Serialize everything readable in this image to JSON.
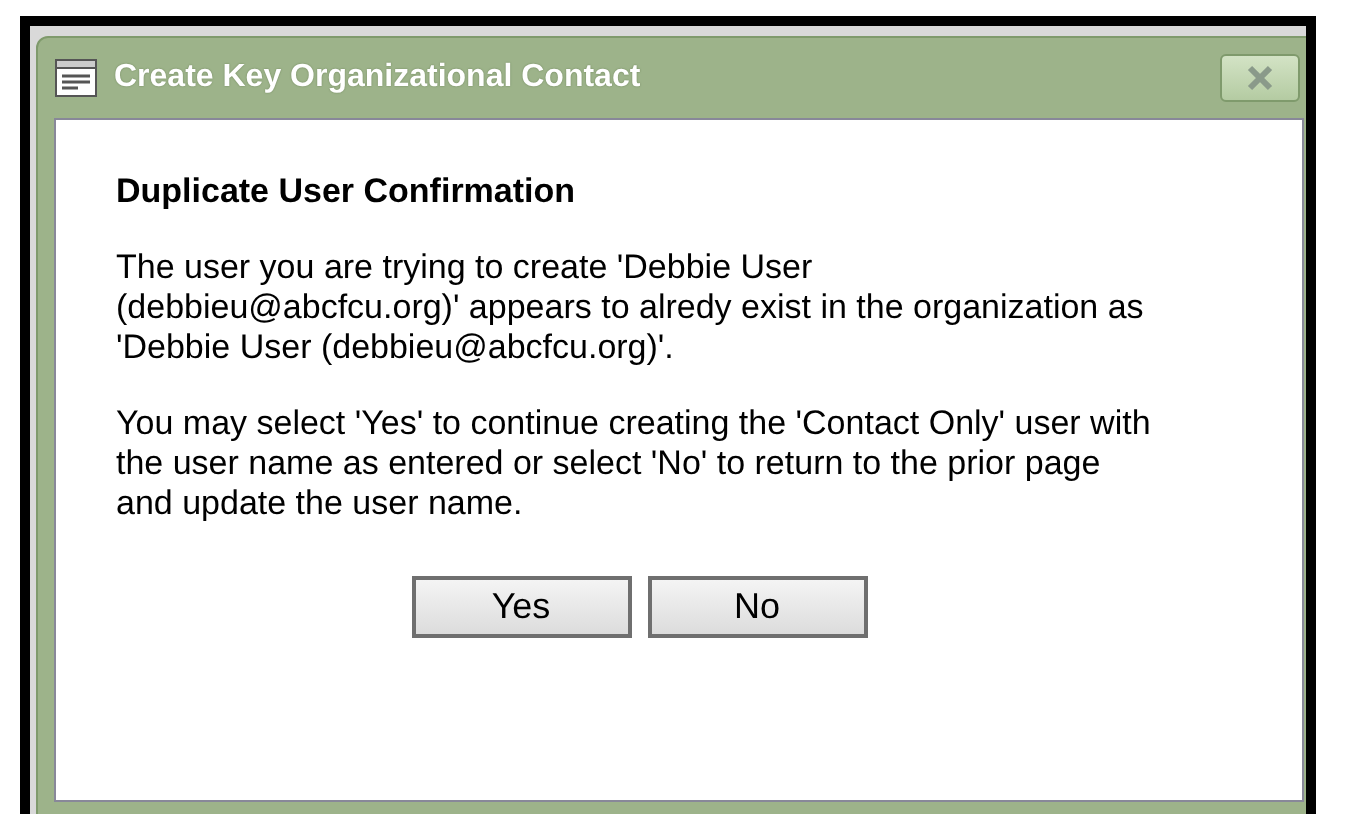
{
  "window": {
    "title": "Create Key Organizational Contact"
  },
  "heading": "Duplicate User Confirmation",
  "paragraphs": [
    "The user you are trying to create 'Debbie User (debbieu@abcfcu.org)' appears to alredy exist in the organization as 'Debbie User (debbieu@abcfcu.org)'.",
    "You may select 'Yes' to continue creating the 'Contact Only' user with the user name as entered or select 'No' to return to the prior page and update the user name."
  ],
  "buttons": [
    "Yes",
    "No"
  ]
}
